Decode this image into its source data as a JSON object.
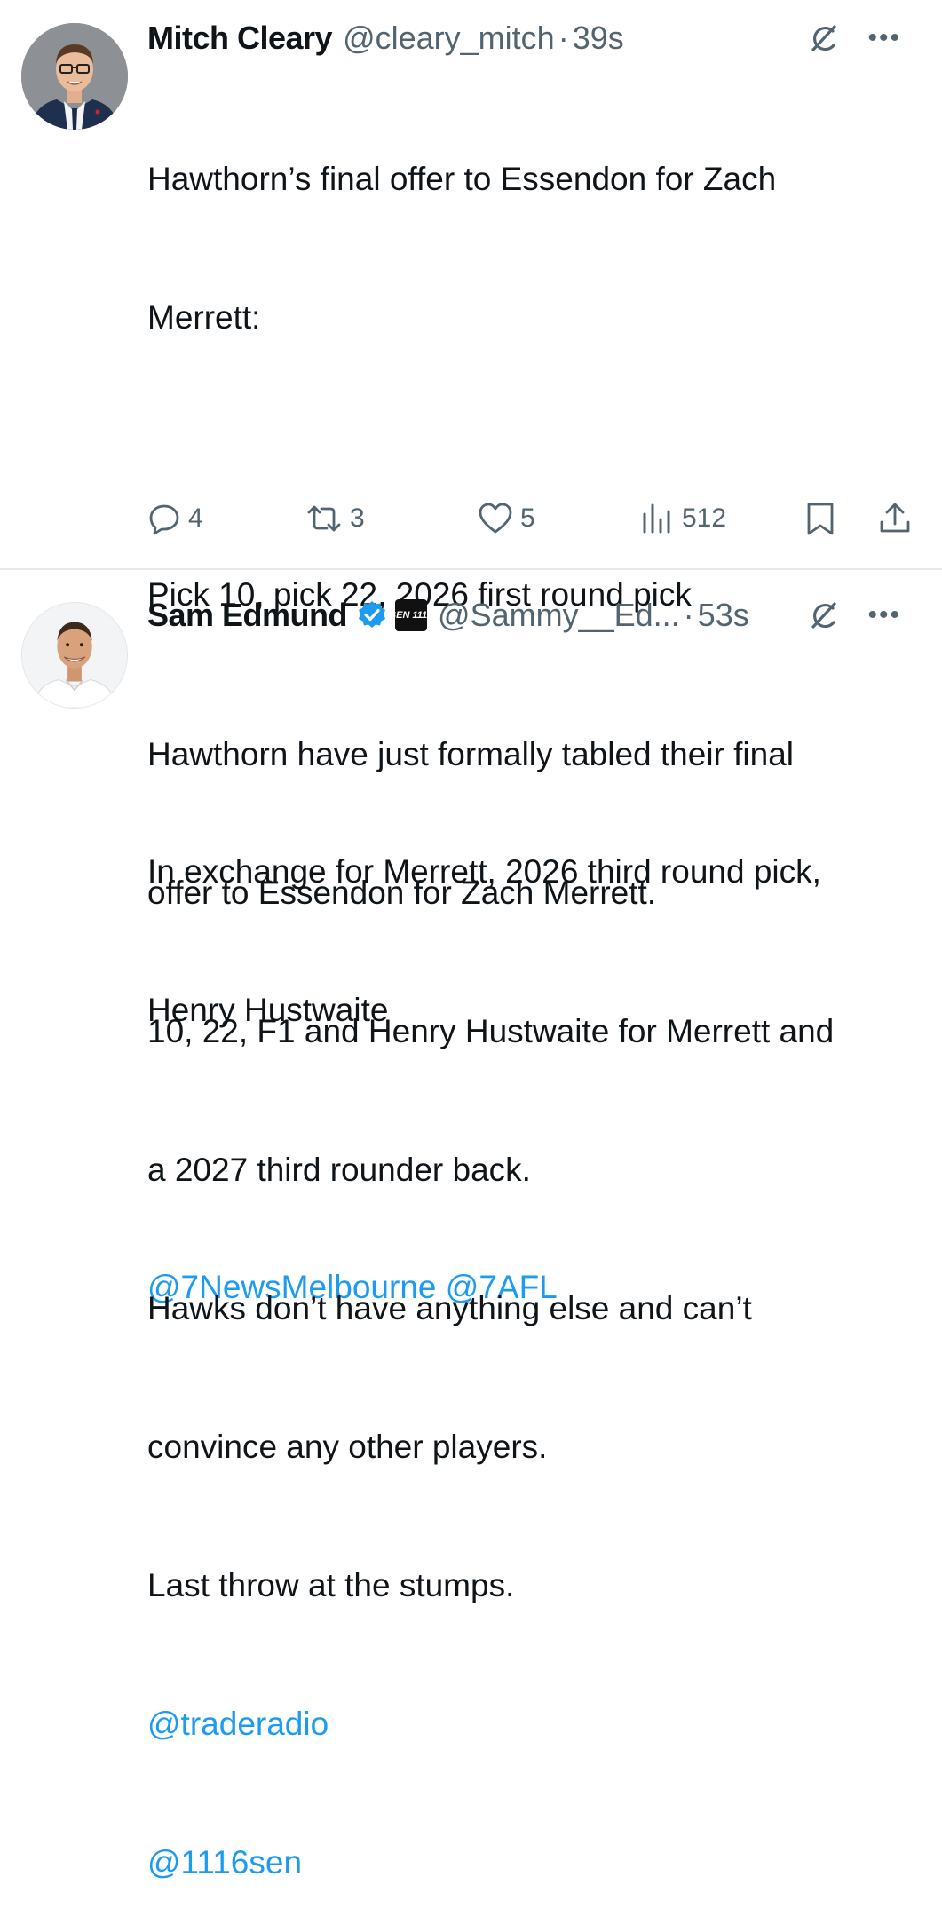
{
  "tweets": [
    {
      "author_name": "Mitch Cleary",
      "handle": "@cleary_mitch",
      "separator": "·",
      "time": "39s",
      "body_lines": [
        "Hawthorn’s final offer to Essendon for Zach",
        "Merrett:",
        "",
        "Pick 10, pick 22, 2026 first round pick",
        "",
        "In exchange for Merrett, 2026 third round pick,",
        "Henry Hustwaite"
      ],
      "mentions": "@7NewsMelbourne @7AFL",
      "replies": "4",
      "reposts": "3",
      "likes": "5",
      "views": "512",
      "icons": [
        "avatar",
        "grok-icon",
        "more-icon",
        "reply-icon",
        "repost-icon",
        "like-icon",
        "views-icon",
        "bookmark-icon",
        "share-icon"
      ]
    },
    {
      "author_name": "Sam Edmund",
      "handle": "@Sammy__Ed...",
      "separator": "·",
      "time": "53s",
      "affiliation_badge": "SEN 1116",
      "body_lines": [
        "Hawthorn have just formally tabled their final",
        "offer to Essendon for Zach Merrett.",
        "10, 22, F1 and Henry Hustwaite for Merrett and",
        "a 2027 third rounder back.",
        "Hawks don’t have anything else and can’t",
        "convince any other players.",
        "Last throw at the stumps."
      ],
      "mention_1": "@traderadio",
      "mention_2": "@1116sen",
      "icons": [
        "avatar",
        "verified-badge-icon",
        "affiliation-badge",
        "grok-icon",
        "more-icon"
      ]
    }
  ],
  "colors": {
    "text": "#0f1419",
    "secondary": "#536471",
    "link": "#1d9bf0",
    "divider": "#e6e9eb"
  }
}
